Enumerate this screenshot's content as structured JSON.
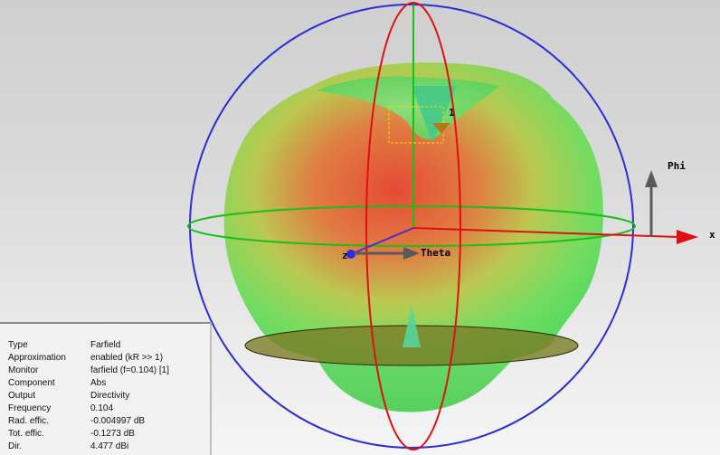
{
  "scene": {
    "axis_labels": {
      "x": "x",
      "z": "z",
      "theta": "Theta",
      "phi": "Phi",
      "port": "1"
    },
    "colors": {
      "background": "#d4d4d4",
      "sphere_outline": "#2b2bd9",
      "theta_ring": "#e01010",
      "phi_ring": "#18c018",
      "x_axis": "#e01010",
      "pattern_high": "#e6452e",
      "pattern_mid": "#d9b33a",
      "pattern_low": "#55d95a",
      "ground_plane": "#6b6b2a"
    }
  },
  "info_panel": {
    "rows": [
      {
        "key": "Type",
        "value": "Farfield"
      },
      {
        "key": "Approximation",
        "value": "enabled (kR >> 1)"
      },
      {
        "key": "Monitor",
        "value": "farfield (f=0.104) [1]"
      },
      {
        "key": "Component",
        "value": "Abs"
      },
      {
        "key": "Output",
        "value": "Directivity"
      },
      {
        "key": "Frequency",
        "value": "0.104"
      },
      {
        "key": "Rad. effic.",
        "value": "-0.004997 dB"
      },
      {
        "key": "Tot. effic.",
        "value": "-0.1273 dB"
      },
      {
        "key": "Dir.",
        "value": "4.477 dBi"
      }
    ]
  }
}
